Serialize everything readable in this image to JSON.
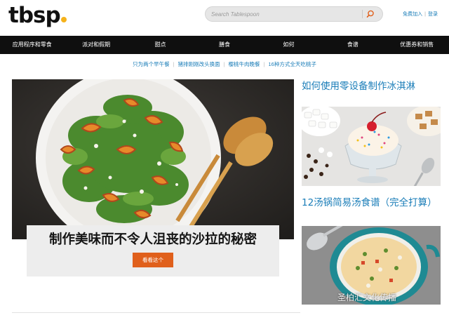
{
  "header": {
    "logo_text": "tbsp",
    "logo_dot_color": "#f5b21b",
    "search_placeholder": "Search Tablespoon",
    "search_icon": "search-icon",
    "login_label": "免费加入",
    "signup_label": "登录"
  },
  "nav": {
    "items": [
      "应用程序和零食",
      "派对和假期",
      "甜点",
      "膳食",
      "如何",
      "食谱",
      "优惠券和销售"
    ]
  },
  "sublinks": [
    "只为两个早午餐",
    "猪排刚刚改头换面",
    "樱桃牛肉晚餐",
    "16种方式全天吃桃子"
  ],
  "hero": {
    "title": "制作美味而不令人沮丧的沙拉的秘密",
    "button_label": "看看这个"
  },
  "side": {
    "story1_title": "如何使用零设备制作冰淇淋",
    "story2_title": "12汤锅简易汤食谱（完全打算）"
  },
  "watermark": "圣柏汇文化传播",
  "colors": {
    "accent": "#e0601c",
    "link": "#1a7db8",
    "nav_bg": "#0f0f0f"
  }
}
